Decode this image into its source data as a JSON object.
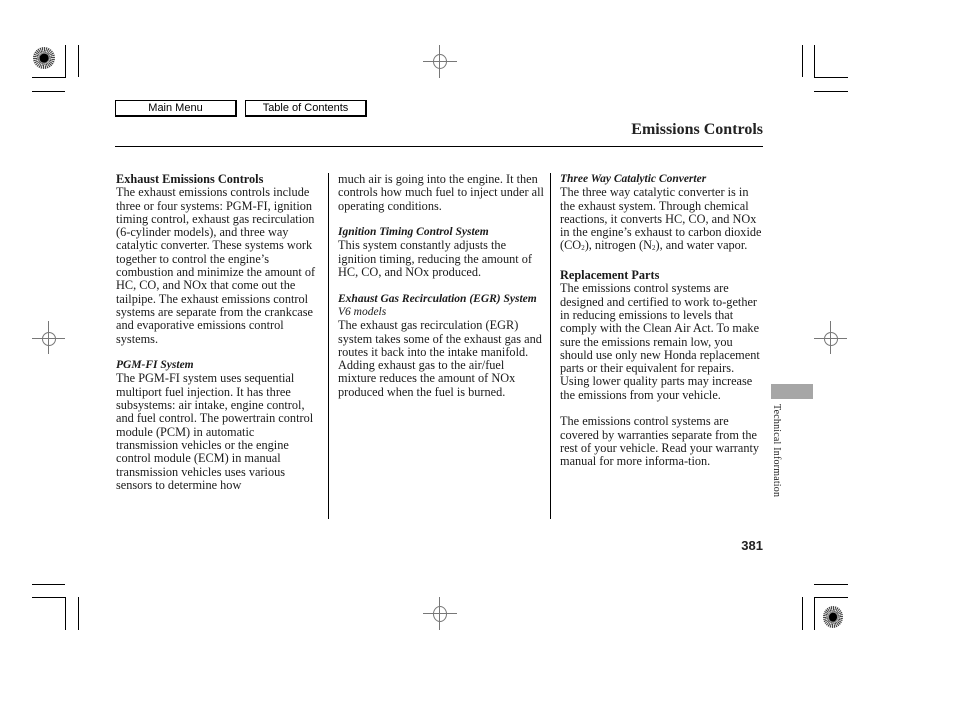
{
  "nav": {
    "main_menu": "Main Menu",
    "table_of_contents": "Table of Contents"
  },
  "header": {
    "title": "Emissions Controls"
  },
  "columns": {
    "col1": {
      "heading": "Exhaust Emissions Controls",
      "intro": "The exhaust emissions controls include three or four systems: PGM-FI, ignition timing control, exhaust gas recirculation (6-cylinder models), and three way catalytic converter. These systems work together to control the engine’s combustion and minimize the amount of HC, CO, and NOx that come out the tailpipe. The exhaust emissions control systems are separate from the crankcase and evaporative emissions control systems.",
      "pgmfi_heading": "PGM-FI System",
      "pgmfi_body": "The PGM-FI system uses sequential multiport fuel injection. It has three subsystems: air intake, engine control, and fuel control. The powertrain control module (PCM) in automatic transmission vehicles or the engine control module (ECM) in manual transmission vehicles uses various sensors to determine how"
    },
    "col2": {
      "continued": "much air is going into the engine. It then controls how much fuel to inject under all operating conditions.",
      "ignition_heading": "Ignition Timing Control System",
      "ignition_body": "This system constantly adjusts the ignition timing, reducing the amount of HC, CO, and NOx produced.",
      "egr_heading": "Exhaust Gas Recirculation (EGR) System",
      "egr_subheading": "V6 models",
      "egr_body": "The exhaust gas recirculation (EGR) system takes some of the exhaust gas and routes it back into the intake manifold. Adding exhaust gas to the air/fuel mixture reduces the amount of NOx produced when the fuel is burned."
    },
    "col3": {
      "catalytic_heading": "Three Way Catalytic Converter",
      "catalytic_body_a": "The three way catalytic converter is in the exhaust system. Through chemical reactions, it converts HC, CO, and NOx in the engine’s exhaust to carbon dioxide (CO",
      "catalytic_sub_1": "2",
      "catalytic_body_b": "), nitrogen (N",
      "catalytic_sub_2": "2",
      "catalytic_body_c": "), and water vapor.",
      "replacement_heading": "Replacement Parts",
      "replacement_body": "The emissions control systems are designed and certified to work to-gether in reducing emissions to levels that comply with the Clean Air Act. To make sure the emissions remain low, you should use only new Honda replacement parts or their equivalent for repairs. Using lower quality parts may increase the emissions from your vehicle.",
      "warranty_body": "The emissions control systems are covered by warranties separate from the rest of your vehicle. Read your warranty manual for more informa-tion."
    }
  },
  "side_tab": {
    "label": "Technical Information",
    "color": "#a6a6a6"
  },
  "footer": {
    "page_number": "381"
  }
}
